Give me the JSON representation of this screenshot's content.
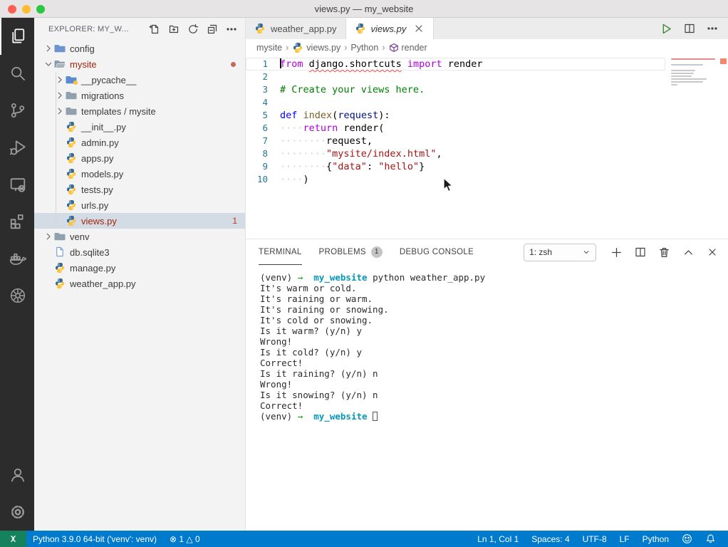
{
  "title_bar": {
    "title": "views.py — my_website"
  },
  "activity_bar": {
    "top": [
      {
        "name": "explorer",
        "icon": "files",
        "active": true
      },
      {
        "name": "search",
        "icon": "search",
        "active": false
      },
      {
        "name": "source-control",
        "icon": "source-control",
        "active": false
      },
      {
        "name": "run-debug",
        "icon": "run-debug",
        "active": false
      },
      {
        "name": "remote-explorer",
        "icon": "remote-explorer",
        "active": false
      },
      {
        "name": "extensions",
        "icon": "extensions",
        "active": false
      },
      {
        "name": "docker",
        "icon": "docker",
        "active": false
      },
      {
        "name": "kubernetes",
        "icon": "kubernetes",
        "active": false
      }
    ],
    "bottom": [
      {
        "name": "accounts",
        "icon": "accounts",
        "active": false
      },
      {
        "name": "settings",
        "icon": "settings",
        "active": false
      }
    ]
  },
  "sidebar": {
    "header": "EXPLORER: MY_W...",
    "actions": [
      {
        "name": "new-file",
        "icon": "new-file"
      },
      {
        "name": "new-folder",
        "icon": "new-folder"
      },
      {
        "name": "refresh-explorer",
        "icon": "refresh"
      },
      {
        "name": "collapse-folders",
        "icon": "collapse-folders"
      },
      {
        "name": "more-actions",
        "icon": "more-actions"
      }
    ],
    "tree": [
      {
        "label": "config",
        "icon": "folder",
        "color": "#6c95cf",
        "depth": 0,
        "chevron": "right"
      },
      {
        "label": "mysite",
        "icon": "folder-open",
        "color": "#8d9ca8",
        "depth": 0,
        "chevron": "down",
        "modified": true,
        "dot": true
      },
      {
        "label": "__pycache__",
        "icon": "folder",
        "color": "#5b8bd0",
        "depth": 1,
        "chevron": "right",
        "pybadge": true
      },
      {
        "label": "migrations",
        "icon": "folder",
        "color": "#90a0ac",
        "depth": 1,
        "chevron": "right"
      },
      {
        "label": "templates / mysite",
        "icon": "folder",
        "color": "#90a0ac",
        "depth": 1,
        "chevron": "right"
      },
      {
        "label": "__init__.py",
        "icon": "python",
        "depth": 1
      },
      {
        "label": "admin.py",
        "icon": "python",
        "depth": 1
      },
      {
        "label": "apps.py",
        "icon": "python",
        "depth": 1
      },
      {
        "label": "models.py",
        "icon": "python",
        "depth": 1
      },
      {
        "label": "tests.py",
        "icon": "python",
        "depth": 1
      },
      {
        "label": "urls.py",
        "icon": "python",
        "depth": 1
      },
      {
        "label": "views.py",
        "icon": "python",
        "depth": 1,
        "modified": true,
        "selected": true,
        "badge": "1"
      },
      {
        "label": "venv",
        "icon": "folder",
        "color": "#90a0ac",
        "depth": 0,
        "chevron": "right"
      },
      {
        "label": "db.sqlite3",
        "icon": "file",
        "depth": 0
      },
      {
        "label": "manage.py",
        "icon": "python",
        "depth": 0
      },
      {
        "label": "weather_app.py",
        "icon": "python",
        "depth": 0
      }
    ]
  },
  "editor": {
    "tabs": [
      {
        "label": "weather_app.py",
        "icon": "python",
        "active": false,
        "preview": false,
        "closable": false
      },
      {
        "label": "views.py",
        "icon": "python",
        "active": true,
        "preview": true,
        "closable": true
      }
    ],
    "actions": [
      {
        "name": "run-python-file",
        "icon": "play"
      },
      {
        "name": "split-editor",
        "icon": "split"
      },
      {
        "name": "more-editor-actions",
        "icon": "more-actions"
      }
    ],
    "breadcrumbs": [
      {
        "label": "mysite"
      },
      {
        "label": "views.py",
        "icon": "python"
      },
      {
        "label": "Python"
      },
      {
        "label": "render",
        "icon": "symbol-method"
      }
    ],
    "code_lines": [
      {
        "num": "1",
        "current": true,
        "segments": [
          {
            "t": "from",
            "c": "k"
          },
          {
            "t": " "
          },
          {
            "t": "django.shortcuts",
            "c": "e"
          },
          {
            "t": " "
          },
          {
            "t": "import",
            "c": "k"
          },
          {
            "t": " render"
          }
        ]
      },
      {
        "num": "2",
        "segments": []
      },
      {
        "num": "3",
        "segments": [
          {
            "t": "# Create your views here.",
            "c": "c"
          }
        ]
      },
      {
        "num": "4",
        "segments": []
      },
      {
        "num": "5",
        "segments": [
          {
            "t": "def",
            "c": "d"
          },
          {
            "t": " "
          },
          {
            "t": "index",
            "c": "f"
          },
          {
            "t": "("
          },
          {
            "t": "request",
            "c": "p"
          },
          {
            "t": "):"
          }
        ]
      },
      {
        "num": "6",
        "segments": [
          {
            "t": "····",
            "c": "w"
          },
          {
            "t": "return",
            "c": "k"
          },
          {
            "t": " render("
          }
        ]
      },
      {
        "num": "7",
        "segments": [
          {
            "t": "········",
            "c": "w"
          },
          {
            "t": "request,"
          }
        ]
      },
      {
        "num": "8",
        "segments": [
          {
            "t": "········",
            "c": "w"
          },
          {
            "t": "\"mysite/index.html\"",
            "c": "s"
          },
          {
            "t": ","
          }
        ]
      },
      {
        "num": "9",
        "segments": [
          {
            "t": "········",
            "c": "w"
          },
          {
            "t": "{"
          },
          {
            "t": "\"data\"",
            "c": "s"
          },
          {
            "t": ": "
          },
          {
            "t": "\"hello\"",
            "c": "s"
          },
          {
            "t": "}"
          }
        ]
      },
      {
        "num": "10",
        "segments": [
          {
            "t": "····",
            "c": "w"
          },
          {
            "t": ")"
          }
        ]
      }
    ]
  },
  "terminal": {
    "tabs": [
      {
        "label": "TERMINAL",
        "active": true
      },
      {
        "label": "PROBLEMS",
        "active": false,
        "badge": "1"
      },
      {
        "label": "DEBUG CONSOLE",
        "active": false
      }
    ],
    "shell_select": "1: zsh",
    "actions": [
      {
        "name": "new-terminal",
        "icon": "plus"
      },
      {
        "name": "split-terminal",
        "icon": "split"
      },
      {
        "name": "kill-terminal",
        "icon": "trash"
      },
      {
        "name": "maximize-panel",
        "icon": "chevron-up"
      },
      {
        "name": "close-panel",
        "icon": "close"
      }
    ],
    "lines": [
      {
        "segments": [
          {
            "t": "(venv) "
          },
          {
            "t": "→",
            "c": "g"
          },
          {
            "t": "  "
          },
          {
            "t": "my_website",
            "c": "b"
          },
          {
            "t": " python weather_app.py"
          }
        ]
      },
      {
        "segments": [
          {
            "t": "It's warm or cold."
          }
        ]
      },
      {
        "segments": [
          {
            "t": "It's raining or warm."
          }
        ]
      },
      {
        "segments": [
          {
            "t": "It's raining or snowing."
          }
        ]
      },
      {
        "segments": [
          {
            "t": "It's cold or snowing."
          }
        ]
      },
      {
        "segments": [
          {
            "t": "Is it warm? (y/n) y"
          }
        ]
      },
      {
        "segments": [
          {
            "t": "Wrong!"
          }
        ]
      },
      {
        "segments": [
          {
            "t": "Is it cold? (y/n) y"
          }
        ]
      },
      {
        "segments": [
          {
            "t": "Correct!"
          }
        ]
      },
      {
        "segments": [
          {
            "t": "Is it raining? (y/n) n"
          }
        ]
      },
      {
        "segments": [
          {
            "t": "Wrong!"
          }
        ]
      },
      {
        "segments": [
          {
            "t": "Is it snowing? (y/n) n"
          }
        ]
      },
      {
        "segments": [
          {
            "t": "Correct!"
          }
        ]
      },
      {
        "cursor": true,
        "segments": [
          {
            "t": "(venv) "
          },
          {
            "t": "→",
            "c": "g"
          },
          {
            "t": "  "
          },
          {
            "t": "my_website",
            "c": "b"
          },
          {
            "t": " "
          }
        ]
      }
    ]
  },
  "status_bar": {
    "left": [
      {
        "name": "remote-indicator",
        "icon": "remote",
        "label": ""
      },
      {
        "name": "python-interpreter",
        "label": "Python 3.9.0 64-bit ('venv': venv)"
      },
      {
        "name": "problems-summary",
        "label": "⊗ 1 △ 0"
      }
    ],
    "right": [
      {
        "name": "cursor-position",
        "label": "Ln 1, Col 1"
      },
      {
        "name": "indentation",
        "label": "Spaces: 4"
      },
      {
        "name": "encoding",
        "label": "UTF-8"
      },
      {
        "name": "eol-sequence",
        "label": "LF"
      },
      {
        "name": "language-mode",
        "label": "Python"
      },
      {
        "name": "feedback",
        "icon": "smiley",
        "label": ""
      },
      {
        "name": "notifications",
        "icon": "bell",
        "label": ""
      }
    ]
  },
  "colors": {
    "accent": "#007acc",
    "remote_green": "#16825d",
    "error_red": "#a1260d",
    "badge_red": "#c72e0f"
  }
}
